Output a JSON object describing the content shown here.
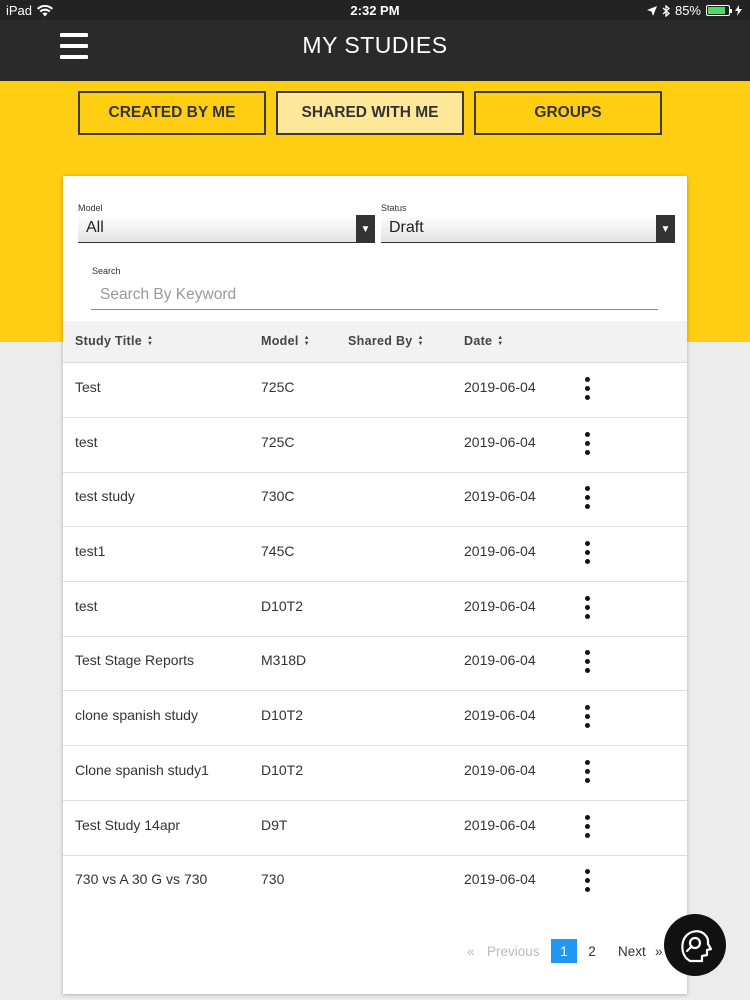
{
  "status_bar": {
    "device": "iPad",
    "time": "2:32 PM",
    "battery": "85%",
    "battery_level": 0.85
  },
  "header": {
    "title": "MY STUDIES"
  },
  "tabs": [
    {
      "label": "CREATED BY ME",
      "active": false
    },
    {
      "label": "SHARED WITH ME",
      "active": true
    },
    {
      "label": "GROUPS",
      "active": false
    }
  ],
  "filters": {
    "model": {
      "label": "Model",
      "value": "All"
    },
    "status": {
      "label": "Status",
      "value": "Draft"
    },
    "search": {
      "label": "Search",
      "placeholder": "Search By Keyword",
      "value": ""
    }
  },
  "table": {
    "columns": [
      "Study Title",
      "Model",
      "Shared By",
      "Date"
    ],
    "rows": [
      {
        "title": "Test",
        "model": "725C",
        "shared_by": "",
        "date": "2019-06-04"
      },
      {
        "title": "test",
        "model": "725C",
        "shared_by": "",
        "date": "2019-06-04"
      },
      {
        "title": "test study",
        "model": "730C",
        "shared_by": "",
        "date": "2019-06-04"
      },
      {
        "title": "test1",
        "model": "745C",
        "shared_by": "",
        "date": "2019-06-04"
      },
      {
        "title": "test",
        "model": "D10T2",
        "shared_by": "",
        "date": "2019-06-04"
      },
      {
        "title": "Test Stage Reports",
        "model": "M318D",
        "shared_by": "",
        "date": "2019-06-04"
      },
      {
        "title": "clone spanish study",
        "model": "D10T2",
        "shared_by": "",
        "date": "2019-06-04"
      },
      {
        "title": "Clone spanish study1",
        "model": "D10T2",
        "shared_by": "",
        "date": "2019-06-04"
      },
      {
        "title": "Test Study 14apr",
        "model": "D9T",
        "shared_by": "",
        "date": "2019-06-04"
      },
      {
        "title": "730 vs A 30 G vs 730",
        "model": "730",
        "shared_by": "",
        "date": "2019-06-04"
      }
    ]
  },
  "pagination": {
    "first_symbol": "«",
    "previous": "Previous",
    "pages": [
      "1",
      "2"
    ],
    "current": "1",
    "next": "Next",
    "last_symbol": "»"
  },
  "colors": {
    "brand_yellow": "#ffcd11",
    "header_dark": "#2a2a2a",
    "page_current": "#2196f3"
  },
  "icons": [
    "wifi-icon",
    "location-icon",
    "bluetooth-icon",
    "battery-icon",
    "hamburger-menu-icon",
    "dropdown-arrow-icon",
    "sort-icon",
    "more-vertical-icon",
    "help-assistant-icon"
  ]
}
